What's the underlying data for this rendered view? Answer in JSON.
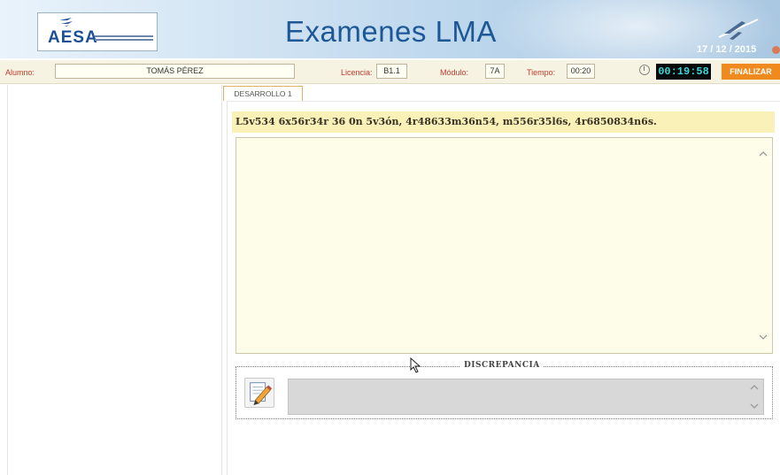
{
  "header": {
    "logo_text": "AESA",
    "logo_subtitle": "AGENCIA ESTATAL DE SEGURIDAD AÉREA",
    "title": "Examenes LMA",
    "date": "17 / 12 / 2015",
    "icons": [
      "plane-icon"
    ]
  },
  "infobar": {
    "alumno_label": "Alumno:",
    "alumno_value": "TOMÁS PÉREZ",
    "licencia_label": "Licencia:",
    "licencia_value": "B1.1",
    "modulo_label": "Módulo:",
    "modulo_value": "7A",
    "tiempo_label": "Tiempo:",
    "tiempo_value": "00:20",
    "timer": "00:19:58",
    "finalizar_label": "FINALIZAR"
  },
  "tabs": [
    {
      "label": "DESARROLLO 1"
    }
  ],
  "question": {
    "text": "L5v534 6x56r34r 36 0n 5v3ón, 4r48633m36n54, m556r35l6s, 4r6850834n6s."
  },
  "answer": {
    "value": ""
  },
  "discrepancia": {
    "legend": "DISCREPANCIA",
    "value": ""
  },
  "colors": {
    "accent_title": "#1d5896",
    "label_red": "#c33a2e",
    "timer_bg": "#06090c",
    "timer_text": "#3bd6d4",
    "finalizar_bg": "#f08a1e",
    "question_bg": "#faf1b8",
    "answer_bg": "#fdfde9"
  }
}
